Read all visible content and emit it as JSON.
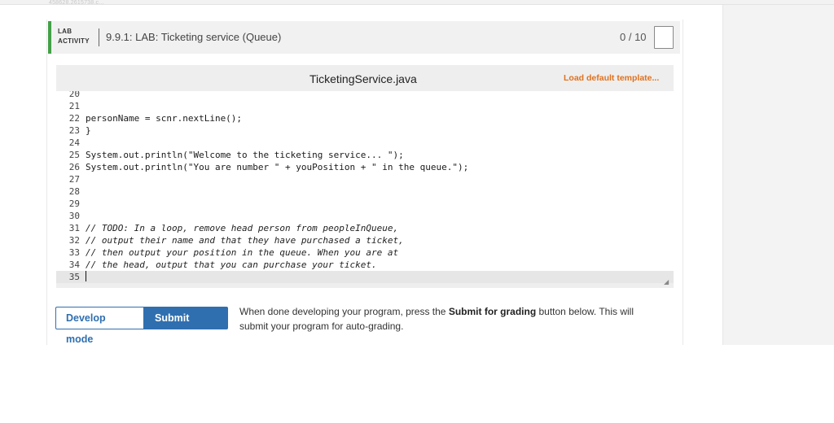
{
  "page": {
    "tiny_id": "458628.2615738.c..."
  },
  "lab": {
    "badge_line1": "LAB",
    "badge_line2": "ACTIVITY",
    "title": "9.9.1: LAB: Ticketing service (Queue)",
    "score": "0 / 10",
    "accent_color": "#43a047"
  },
  "editor": {
    "file_name": "TicketingService.java",
    "load_template_label": "Load default template...",
    "lines": [
      {
        "n": "20",
        "text": ""
      },
      {
        "n": "21",
        "text": ""
      },
      {
        "n": "22",
        "text": "personName = scnr.nextLine();"
      },
      {
        "n": "23",
        "text": "}"
      },
      {
        "n": "24",
        "text": ""
      },
      {
        "n": "25",
        "text": "System.out.println(\"Welcome to the ticketing service... \");"
      },
      {
        "n": "26",
        "text": "System.out.println(\"You are number \" + youPosition + \" in the queue.\");"
      },
      {
        "n": "27",
        "text": ""
      },
      {
        "n": "28",
        "text": ""
      },
      {
        "n": "29",
        "text": ""
      },
      {
        "n": "30",
        "text": ""
      },
      {
        "n": "31",
        "text": "// TODO: In a loop, remove head person from peopleInQueue,"
      },
      {
        "n": "32",
        "text": "// output their name and that they have purchased a ticket,"
      },
      {
        "n": "33",
        "text": "// then output your position in the queue. When you are at"
      },
      {
        "n": "34",
        "text": "// the head, output that you can purchase your ticket."
      },
      {
        "n": "35",
        "text": ""
      }
    ]
  },
  "modes": {
    "develop_label": "Develop mode",
    "submit_label": "Submit mode",
    "help_prefix": "When done developing your program, press the ",
    "help_bold": "Submit for grading",
    "help_suffix": " button below. This will submit your program for auto-grading.",
    "accent_color": "#2f6fb0"
  }
}
